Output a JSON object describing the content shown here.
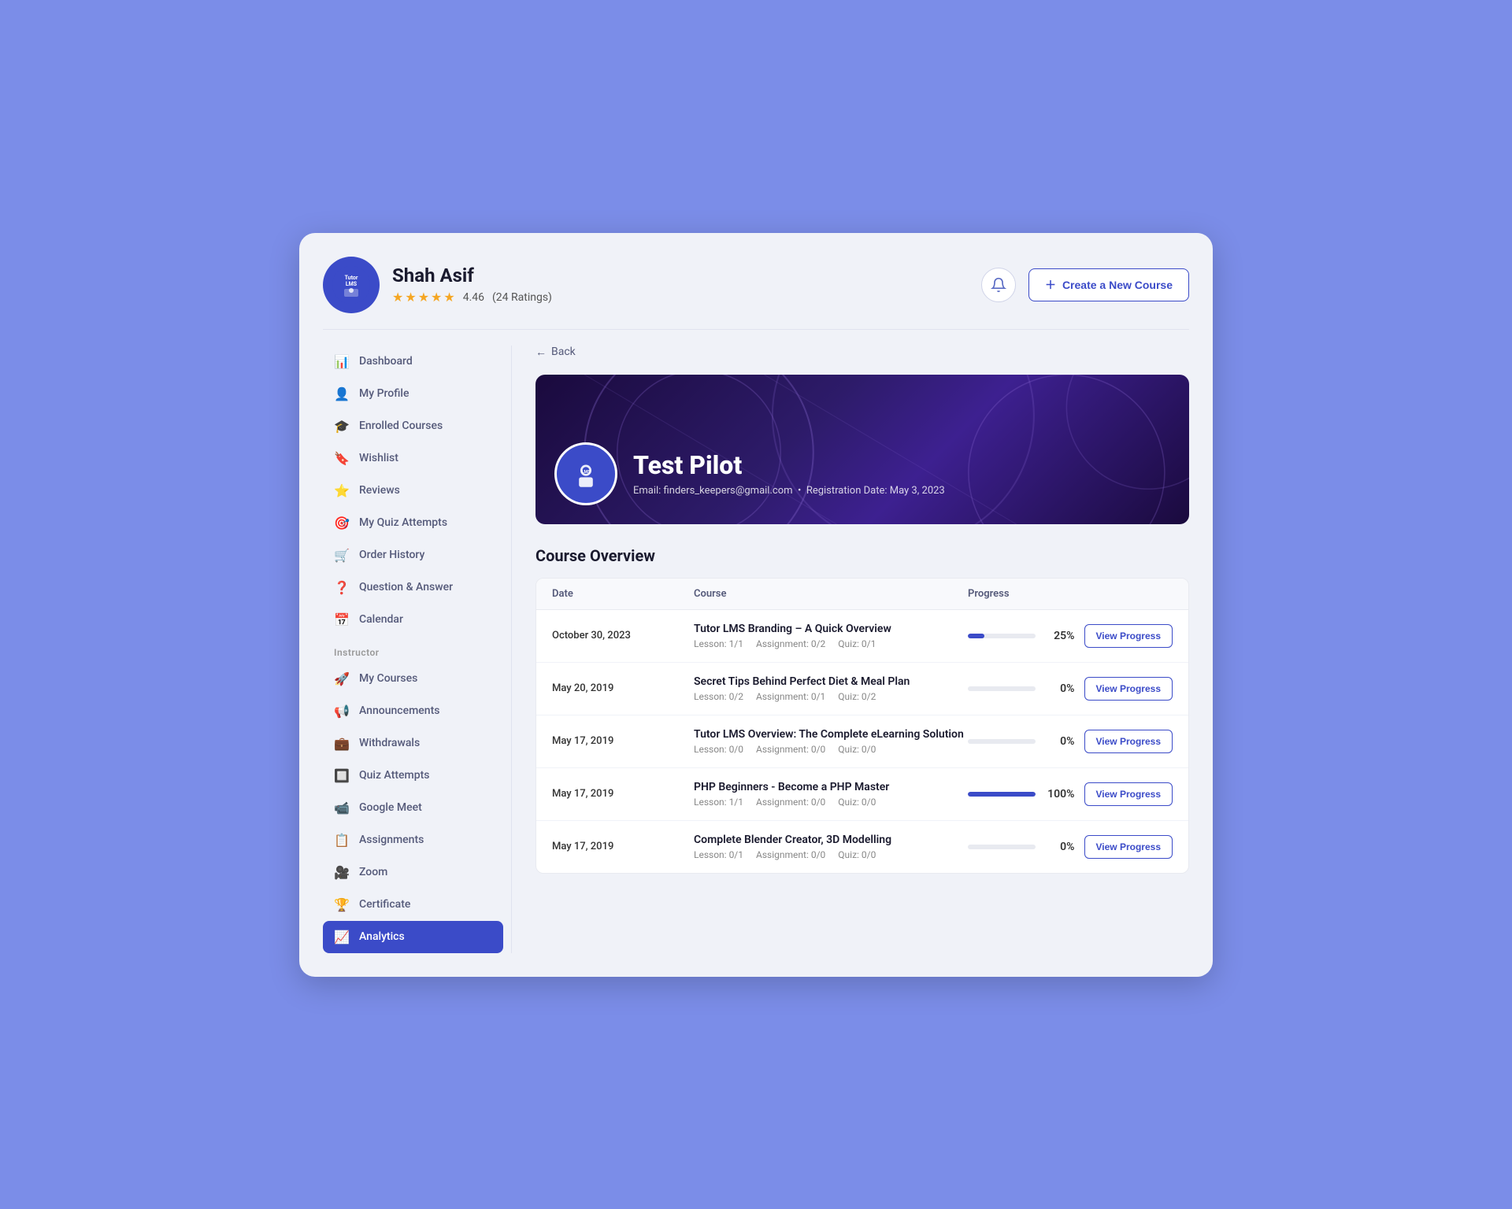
{
  "header": {
    "logo_alt": "Tutor LMS",
    "user_name": "Shah Asif",
    "rating_value": "4.46",
    "rating_label": "(24 Ratings)",
    "bell_label": "Notifications",
    "create_course_label": "Create a New Course"
  },
  "sidebar": {
    "nav_items": [
      {
        "id": "dashboard",
        "label": "Dashboard",
        "icon": "📊",
        "active": false
      },
      {
        "id": "my-profile",
        "label": "My Profile",
        "icon": "👤",
        "active": false
      },
      {
        "id": "enrolled-courses",
        "label": "Enrolled Courses",
        "icon": "🎓",
        "active": false
      },
      {
        "id": "wishlist",
        "label": "Wishlist",
        "icon": "🔖",
        "active": false
      },
      {
        "id": "reviews",
        "label": "Reviews",
        "icon": "⭐",
        "active": false
      },
      {
        "id": "my-quiz-attempts",
        "label": "My Quiz Attempts",
        "icon": "🎯",
        "active": false
      },
      {
        "id": "order-history",
        "label": "Order History",
        "icon": "🛒",
        "active": false
      },
      {
        "id": "question-answer",
        "label": "Question & Answer",
        "icon": "❓",
        "active": false
      },
      {
        "id": "calendar",
        "label": "Calendar",
        "icon": "📅",
        "active": false
      }
    ],
    "instructor_label": "Instructor",
    "instructor_items": [
      {
        "id": "my-courses",
        "label": "My Courses",
        "icon": "🚀",
        "active": false
      },
      {
        "id": "announcements",
        "label": "Announcements",
        "icon": "📢",
        "active": false
      },
      {
        "id": "withdrawals",
        "label": "Withdrawals",
        "icon": "💼",
        "active": false
      },
      {
        "id": "quiz-attempts",
        "label": "Quiz Attempts",
        "icon": "🔲",
        "active": false
      },
      {
        "id": "google-meet",
        "label": "Google Meet",
        "icon": "📹",
        "active": false
      },
      {
        "id": "assignments",
        "label": "Assignments",
        "icon": "📋",
        "active": false
      },
      {
        "id": "zoom",
        "label": "Zoom",
        "icon": "🎥",
        "active": false
      },
      {
        "id": "certificate",
        "label": "Certificate",
        "icon": "🏆",
        "active": false
      },
      {
        "id": "analytics",
        "label": "Analytics",
        "icon": "📈",
        "active": true
      }
    ]
  },
  "back_label": "Back",
  "course_banner": {
    "title": "Test Pilot",
    "email": "Email: finders_keepers@gmail.com",
    "registration": "Registration Date: May 3, 2023"
  },
  "course_overview": {
    "section_title": "Course Overview",
    "table_headers": [
      "Date",
      "Course",
      "Progress"
    ],
    "rows": [
      {
        "date": "October 30, 2023",
        "title": "Tutor LMS Branding – A Quick Overview",
        "lesson": "1/1",
        "assignment": "0/2",
        "quiz": "0/1",
        "progress": 25,
        "progress_label": "25%",
        "progress_color": "#3b4bc8"
      },
      {
        "date": "May 20, 2019",
        "title": "Secret Tips Behind Perfect Diet & Meal Plan",
        "lesson": "0/2",
        "assignment": "0/1",
        "quiz": "0/2",
        "progress": 0,
        "progress_label": "0%",
        "progress_color": "#e0e3ef"
      },
      {
        "date": "May 17, 2019",
        "title": "Tutor LMS Overview: The Complete eLearning Solution",
        "lesson": "0/0",
        "assignment": "0/0",
        "quiz": "0/0",
        "progress": 0,
        "progress_label": "0%",
        "progress_color": "#e0e3ef"
      },
      {
        "date": "May 17, 2019",
        "title": "PHP Beginners - Become a PHP Master",
        "lesson": "1/1",
        "assignment": "0/0",
        "quiz": "0/0",
        "progress": 100,
        "progress_label": "100%",
        "progress_color": "#3b4bc8"
      },
      {
        "date": "May 17, 2019",
        "title": "Complete Blender Creator, 3D Modelling",
        "lesson": "0/1",
        "assignment": "0/0",
        "quiz": "0/0",
        "progress": 0,
        "progress_label": "0%",
        "progress_color": "#e0e3ef"
      }
    ],
    "view_progress_label": "View Progress"
  }
}
